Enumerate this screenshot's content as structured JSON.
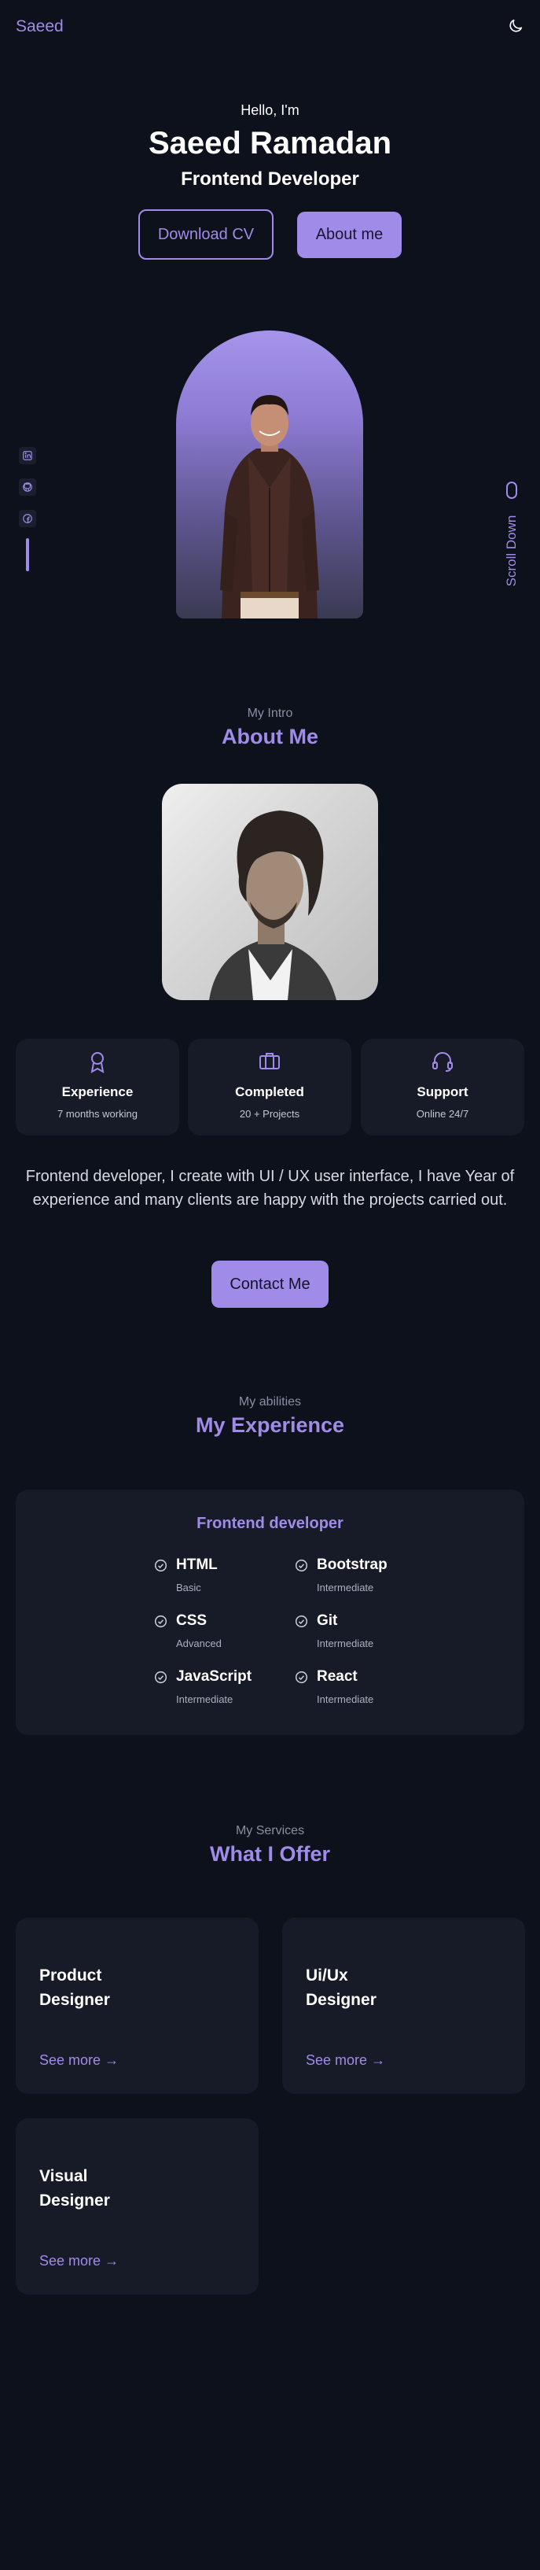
{
  "header": {
    "logo": "Saeed",
    "theme_icon": "moon-icon"
  },
  "hero": {
    "hello": "Hello, I'm",
    "name": "Saeed Ramadan",
    "role": "Frontend Developer",
    "download_cv": "Download CV",
    "about_me": "About me",
    "scroll_down": "Scroll Down"
  },
  "socials": [
    "linkedin-icon",
    "github-icon",
    "facebook-icon"
  ],
  "about": {
    "subtitle": "My Intro",
    "title": "About Me",
    "cards": [
      {
        "icon": "award-icon",
        "title": "Experience",
        "subtitle": "7 months working"
      },
      {
        "icon": "briefcase-icon",
        "title": "Completed",
        "subtitle": "20 + Projects"
      },
      {
        "icon": "headset-icon",
        "title": "Support",
        "subtitle": "Online 24/7"
      }
    ],
    "description": "Frontend developer, I create with UI / UX user interface, I have Year of experience and many clients are happy with the projects carried out.",
    "contact": "Contact Me"
  },
  "experience": {
    "subtitle": "My abilities",
    "title": "My Experience",
    "card_title": "Frontend developer",
    "skills": [
      {
        "name": "HTML",
        "level": "Basic"
      },
      {
        "name": "Bootstrap",
        "level": "Intermediate"
      },
      {
        "name": "CSS",
        "level": "Advanced"
      },
      {
        "name": "Git",
        "level": "Intermediate"
      },
      {
        "name": "JavaScript",
        "level": "Intermediate"
      },
      {
        "name": "React",
        "level": "Intermediate"
      }
    ]
  },
  "services": {
    "subtitle": "My Services",
    "title": "What I Offer",
    "items": [
      {
        "line1": "Product",
        "line2": "Designer",
        "more": "See more"
      },
      {
        "line1": "Ui/Ux",
        "line2": "Designer",
        "more": "See more"
      },
      {
        "line1": "Visual",
        "line2": "Designer",
        "more": "See more"
      }
    ]
  },
  "colors": {
    "accent": "#a08ce8",
    "background": "#0d111c",
    "card": "#171b27"
  }
}
